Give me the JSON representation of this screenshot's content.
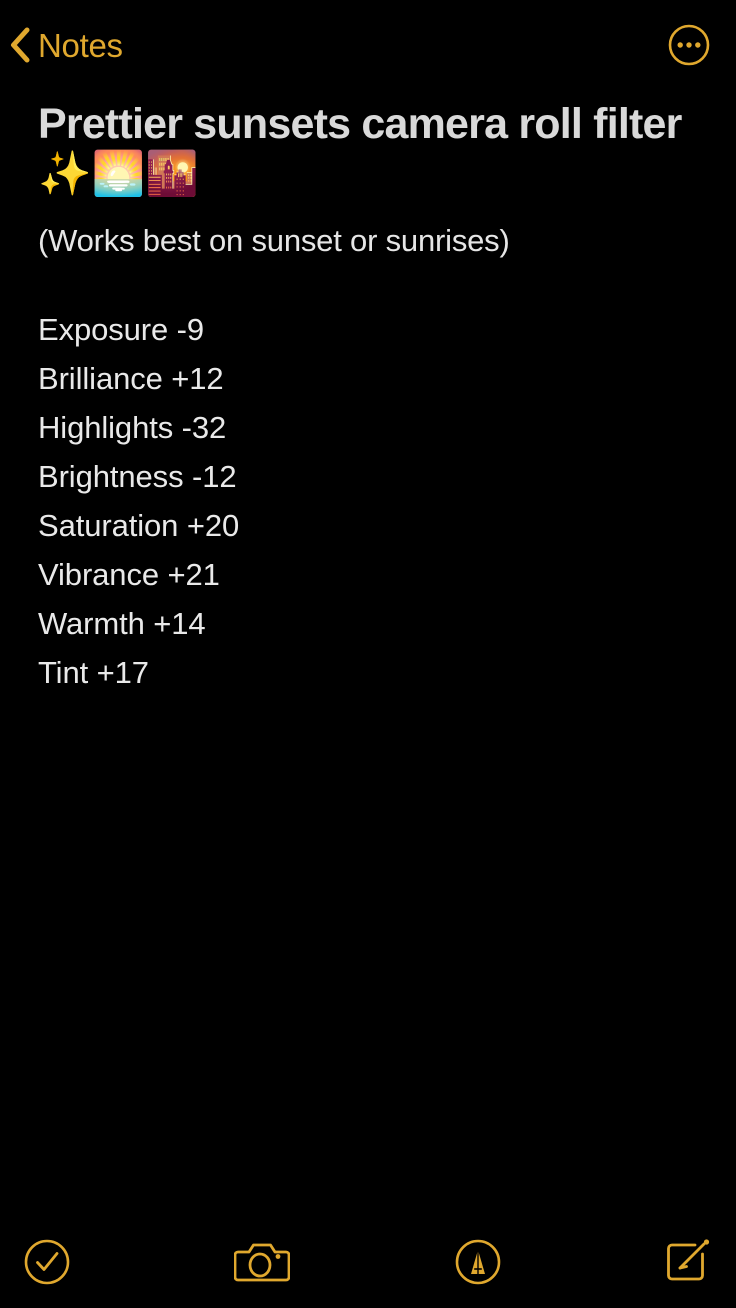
{
  "app": "Notes",
  "theme": {
    "background": "#000000",
    "accent": "#E0A82E",
    "title_color": "#D9D9D9",
    "body_color": "#E9E9E9"
  },
  "navbar": {
    "back_label": "Notes",
    "back_icon": "chevron-left-icon",
    "more_icon": "ellipsis-circle-icon"
  },
  "note": {
    "title_text": "Prettier sunsets camera roll filter ",
    "title_emoji_sparkles": "✨",
    "title_emoji_sunrise": "🌅",
    "title_emoji_sunset_city": "🌇",
    "subtitle": "(Works best on sunset or sunrises)",
    "settings": [
      {
        "name": "Exposure",
        "value": "-9"
      },
      {
        "name": "Brilliance",
        "value": "+12"
      },
      {
        "name": "Highlights",
        "value": "-32"
      },
      {
        "name": "Brightness",
        "value": "-12"
      },
      {
        "name": "Saturation",
        "value": "+20"
      },
      {
        "name": "Vibrance",
        "value": "+21"
      },
      {
        "name": "Warmth",
        "value": "+14"
      },
      {
        "name": "Tint",
        "value": "+17"
      }
    ],
    "settings_lines": [
      "Exposure -9",
      "Brilliance +12",
      "Highlights -32",
      "Brightness -12",
      "Saturation +20",
      "Vibrance +21",
      "Warmth +14",
      "Tint +17"
    ]
  },
  "toolbar": {
    "items": [
      {
        "icon": "checklist-circle-icon"
      },
      {
        "icon": "camera-icon"
      },
      {
        "icon": "markup-pen-circle-icon"
      },
      {
        "icon": "compose-icon"
      }
    ]
  }
}
